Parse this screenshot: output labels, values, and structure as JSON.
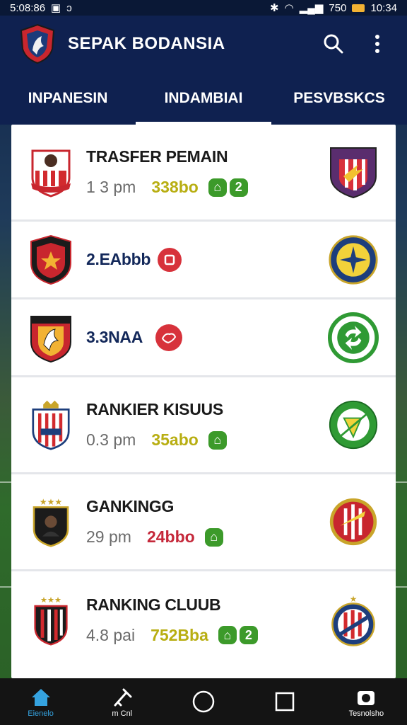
{
  "status_bar": {
    "time": "5:08:86",
    "right_text": "750",
    "clock": "10:34"
  },
  "app": {
    "title": "SEPAK BODANSIA"
  },
  "tabs": [
    {
      "label": "INPANESIN"
    },
    {
      "label": "INDAMBIAI"
    },
    {
      "label": "PESVBSKCS"
    }
  ],
  "rows": [
    {
      "title": "TRASFER PEMAIN",
      "time": "1 3 pm",
      "score": "338bo",
      "badges": [
        "⌂",
        "2"
      ]
    },
    {
      "title": "2.EAbbb"
    },
    {
      "title": "3.3NAA"
    },
    {
      "title": "RANKIER KISUUS",
      "time": "0.3 pm",
      "score": "35abo",
      "badges": [
        "⌂"
      ]
    },
    {
      "title": "GANKINGG",
      "time": "29 pm",
      "score": "24bbo",
      "badges": [
        "⌂"
      ]
    },
    {
      "title": "RANKING CLUUB",
      "time": "4.8 pai",
      "score": "752Bba",
      "badges": [
        "⌂",
        "2"
      ]
    }
  ],
  "bottom_nav": [
    {
      "label": "Eienelo",
      "icon": "home-icon"
    },
    {
      "label": "m Cnl",
      "icon": "tools-icon"
    },
    {
      "label": "",
      "icon": "circle-icon"
    },
    {
      "label": "",
      "icon": "square-icon"
    },
    {
      "label": "Tesnolsho",
      "icon": "camera-icon"
    }
  ],
  "colors": {
    "navy": "#0f2150",
    "olive_score": "#b8ae12",
    "red_score": "#c5283a",
    "badge_green": "#3c9a2a",
    "active_nav": "#35a3e0"
  }
}
